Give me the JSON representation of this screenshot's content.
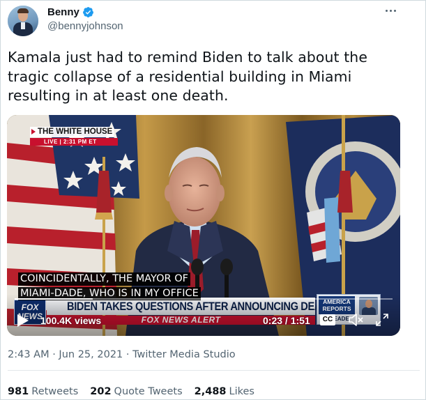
{
  "author": {
    "display_name": "Benny",
    "handle": "@bennyjohnson",
    "verified": true,
    "verified_color": "#1d9bf0"
  },
  "tweet": {
    "text": "Kamala just had to remind Biden to talk about the tragic collapse of a residential building in Miami resulting in at least one death."
  },
  "video": {
    "bug_title": "THE WHITE HOUSE",
    "bug_live": "LIVE | 2:31 PM ET",
    "caption_line1": "COINCIDENTALLY, THE MAYOR OF",
    "caption_line2": "MIAMI-DADE, WHO IS IN MY OFFICE",
    "channel_logo": "FOX NEWS",
    "headline": "BIDEN TAKES QUESTIONS AFTER ANNOUNCING DEAL",
    "alert": "FOX NEWS ALERT",
    "show_logo": "AMERICA REPORTS",
    "show_host": "KILMEADE",
    "views": "100.4K views",
    "time": "0:23 / 1:51",
    "progress_fraction": 0.207,
    "cc_label": "CC"
  },
  "meta": {
    "timestamp": "2:43 AM · Jun 25, 2021 · Twitter Media Studio"
  },
  "stats": {
    "retweets_count": "981",
    "retweets_label": "Retweets",
    "quotes_count": "202",
    "quotes_label": "Quote Tweets",
    "likes_count": "2,488",
    "likes_label": "Likes"
  }
}
